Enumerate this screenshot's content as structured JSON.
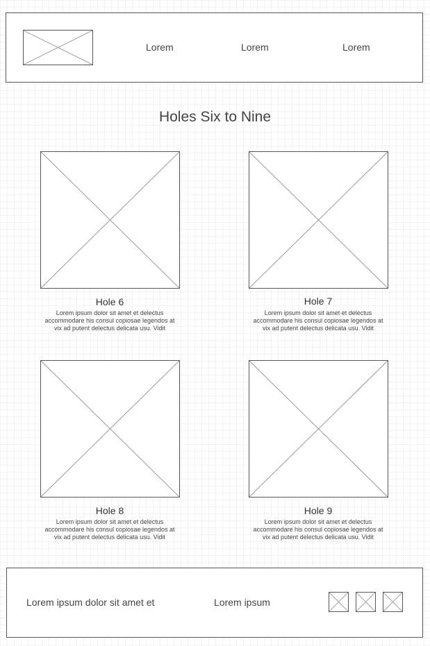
{
  "header": {
    "nav": [
      "Lorem",
      "Lorem",
      "Lorem"
    ]
  },
  "page": {
    "title": "Holes Six to Nine"
  },
  "holes": [
    {
      "title": "Hole 6",
      "text": "Lorem ipsum dolor sit amet et delectus accommodare his consul copiosae legendos at vix ad putent delectus delicata usu. Vidit"
    },
    {
      "title": "Hole 7",
      "text": "Lorem ipsum dolor sit amet et delectus accommodare his consul copiosae legendos at vix ad putent delectus delicata usu. Vidit"
    },
    {
      "title": "Hole 8",
      "text": "Lorem ipsum dolor sit amet et delectus accommodare his consul copiosae legendos at vix ad putent delectus delicata usu. Vidit"
    },
    {
      "title": "Hole 9",
      "text": "Lorem ipsum dolor sit amet et delectus accommodare his consul copiosae legendos at vix ad putent delectus delicata usu. Vidit"
    }
  ],
  "footer": {
    "text": "Lorem ipsum dolor sit amet et",
    "link": "Lorem ipsum"
  }
}
